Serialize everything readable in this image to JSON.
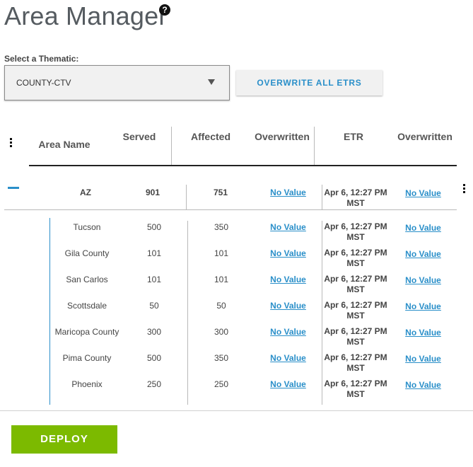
{
  "page": {
    "title": "Area Manager",
    "help_icon": "question-circle-icon"
  },
  "thematic": {
    "label": "Select a Thematic:",
    "selected": "COUNTY-CTV"
  },
  "overwrite_button": "OVERWRITE ALL ETRS",
  "table": {
    "headers": {
      "area_name": "Area Name",
      "served": "Served",
      "affected": "Affected",
      "overwritten_1": "Overwritten",
      "etr": "ETR",
      "overwritten_2": "Overwritten"
    },
    "parent": {
      "name": "AZ",
      "served": "901",
      "affected": "751",
      "overwritten": "No Value",
      "etr_line1": "Apr 6, 12:27 PM",
      "etr_line2": "MST",
      "etr_overwritten": "No Value"
    },
    "children": [
      {
        "name": "Tucson",
        "served": "500",
        "affected": "350",
        "overwritten": "No Value",
        "etr_line1": "Apr 6, 12:27 PM",
        "etr_line2": "MST",
        "etr_overwritten": "No Value"
      },
      {
        "name": "Gila County",
        "served": "101",
        "affected": "101",
        "overwritten": "No Value",
        "etr_line1": "Apr 6, 12:27 PM",
        "etr_line2": "MST",
        "etr_overwritten": "No Value"
      },
      {
        "name": "San Carlos",
        "served": "101",
        "affected": "101",
        "overwritten": "No Value",
        "etr_line1": "Apr 6, 12:27 PM",
        "etr_line2": "MST",
        "etr_overwritten": "No Value"
      },
      {
        "name": "Scottsdale",
        "served": "50",
        "affected": "50",
        "overwritten": "No Value",
        "etr_line1": "Apr 6, 12:27 PM",
        "etr_line2": "MST",
        "etr_overwritten": "No Value"
      },
      {
        "name": "Maricopa County",
        "served": "300",
        "affected": "300",
        "overwritten": "No Value",
        "etr_line1": "Apr 6, 12:27 PM",
        "etr_line2": "MST",
        "etr_overwritten": "No Value"
      },
      {
        "name": "Pima County",
        "served": "500",
        "affected": "350",
        "overwritten": "No Value",
        "etr_line1": "Apr 6, 12:27 PM",
        "etr_line2": "MST",
        "etr_overwritten": "No Value"
      },
      {
        "name": "Phoenix",
        "served": "250",
        "affected": "250",
        "overwritten": "No Value",
        "etr_line1": "Apr 6, 12:27 PM",
        "etr_line2": "MST",
        "etr_overwritten": "No Value"
      }
    ]
  },
  "deploy_button": "DEPLOY",
  "colors": {
    "accent": "#2a8fc9",
    "deploy": "#7cba00"
  }
}
